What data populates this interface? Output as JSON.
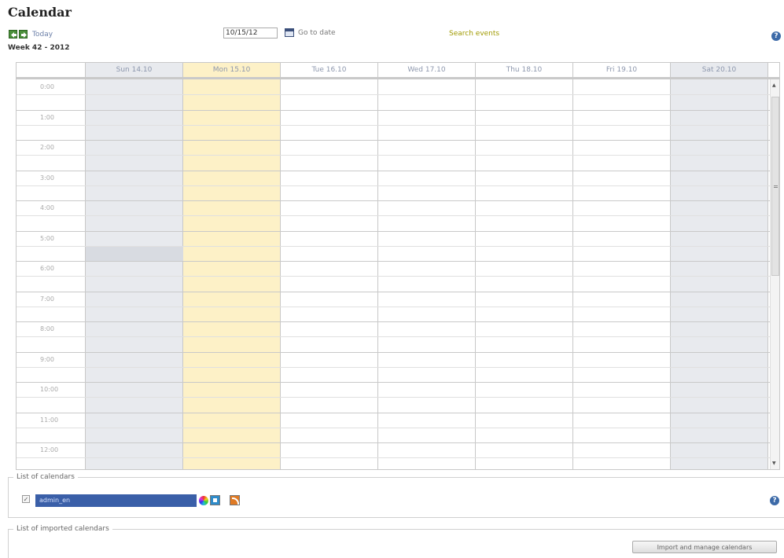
{
  "page": {
    "title": "Calendar"
  },
  "toolbar": {
    "prev_icon": "arrow-left-icon",
    "next_icon": "arrow-right-icon",
    "today_label": "Today",
    "week_label": "Week 42 - 2012",
    "date_value": "10/15/12",
    "goto_label": "Go to date",
    "search_label": "Search events",
    "help_symbol": "?"
  },
  "calendar": {
    "days": [
      {
        "label": "Sun 14.10",
        "kind": "weekend"
      },
      {
        "label": "Mon 15.10",
        "kind": "today"
      },
      {
        "label": "Tue 16.10",
        "kind": "weekday"
      },
      {
        "label": "Wed 17.10",
        "kind": "weekday"
      },
      {
        "label": "Thu 18.10",
        "kind": "weekday"
      },
      {
        "label": "Fri 19.10",
        "kind": "weekday"
      },
      {
        "label": "Sat 20.10",
        "kind": "weekend"
      }
    ],
    "hours": [
      "0:00",
      "1:00",
      "2:00",
      "3:00",
      "4:00",
      "5:00",
      "6:00",
      "7:00",
      "8:00",
      "9:00",
      "10:00",
      "11:00",
      "12:00"
    ],
    "colors": {
      "weekend": "#e8eaee",
      "today": "#fdf1c7",
      "weekday": "#ffffff"
    }
  },
  "calendars_section": {
    "legend": "List of calendars",
    "items": [
      {
        "name": "admin_en",
        "checked": true,
        "color": "#3a5fa8"
      }
    ],
    "icons": [
      "color-wheel-icon",
      "export-icon",
      "rss-icon"
    ]
  },
  "imported_section": {
    "legend": "List of imported calendars",
    "import_button": "Import and manage calendars"
  }
}
